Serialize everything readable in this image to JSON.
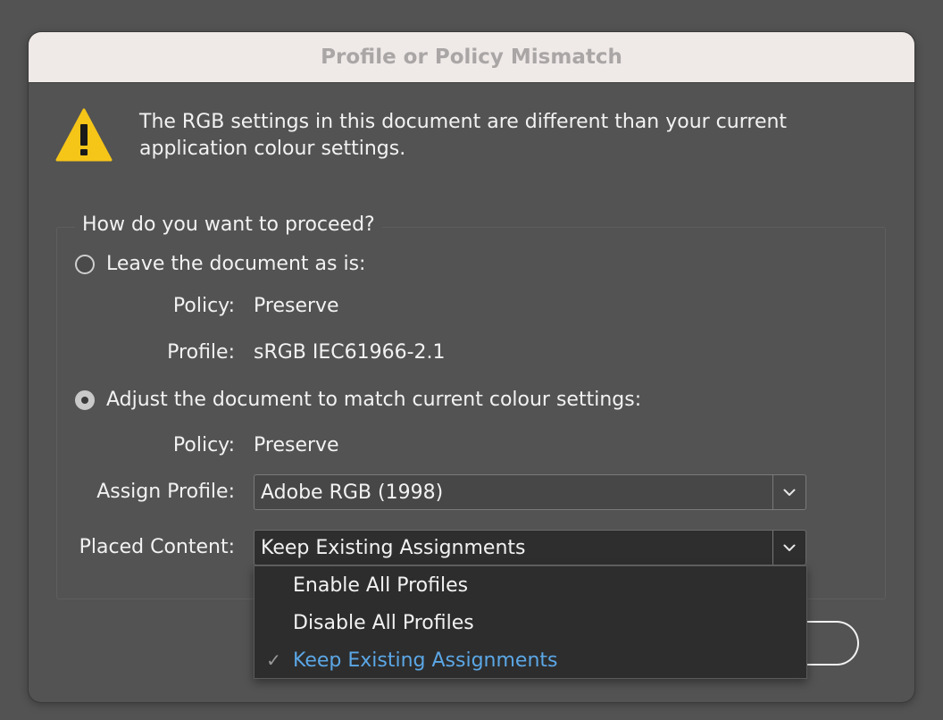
{
  "dialog": {
    "title": "Profile or Policy Mismatch",
    "message": "The RGB settings in this document are different than your current application colour settings."
  },
  "group": {
    "legend": "How do you want to proceed?",
    "option_leave": {
      "label": "Leave the document as is:",
      "checked": false,
      "policy_label": "Policy:",
      "policy_value": "Preserve",
      "profile_label": "Profile:",
      "profile_value": "sRGB IEC61966-2.1"
    },
    "option_adjust": {
      "label": "Adjust the document to match current colour settings:",
      "checked": true,
      "policy_label": "Policy:",
      "policy_value": "Preserve",
      "assign_profile_label": "Assign Profile:",
      "assign_profile_value": "Adobe RGB (1998)",
      "placed_content_label": "Placed Content:",
      "placed_content_value": "Keep Existing Assignments"
    }
  },
  "dropdown_menu": {
    "items": [
      {
        "label": "Enable All Profiles",
        "selected": false
      },
      {
        "label": "Disable All Profiles",
        "selected": false
      },
      {
        "label": "Keep Existing Assignments",
        "selected": true
      }
    ],
    "check_glyph": "✓"
  },
  "colors": {
    "background": "#535353",
    "titlebar": "#efe9e8",
    "warning_yellow": "#f5c518",
    "selected_text": "#5ba7e6"
  },
  "icons": {
    "warning": "warning-triangle-icon",
    "chevron": "chevron-down-icon"
  }
}
